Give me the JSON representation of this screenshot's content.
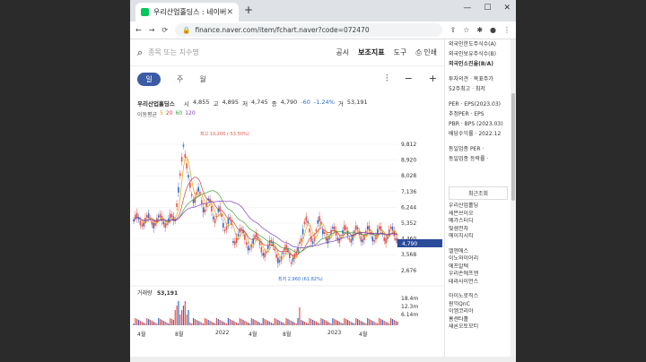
{
  "browser": {
    "tab_title": "우리산업홀딩스 : 네이버 증권",
    "url": "finance.naver.com/item/fchart.naver?code=072470"
  },
  "search": {
    "placeholder": "종목 또는 지수명",
    "links": [
      "공시",
      "보조지표",
      "도구",
      "인쇄"
    ]
  },
  "periods": [
    "일",
    "주",
    "월"
  ],
  "quote": {
    "name": "우리산업홀딩스",
    "open_label": "시",
    "open": "4,855",
    "high_label": "고",
    "high": "4,895",
    "low_label": "저",
    "low": "4,745",
    "close_label": "종",
    "close": "4,790",
    "change": "-60",
    "pct": "-1.24%",
    "vol_label": "거",
    "vol": "53,191"
  },
  "ma": {
    "label": "이동평균",
    "values": [
      "5",
      "20",
      "60",
      "120"
    ]
  },
  "chart_data": {
    "type": "line",
    "scale_label": "Linear",
    "y_ticks": [
      "9,812",
      "8,920",
      "8,028",
      "7,136",
      "6,244",
      "5,352",
      "4,460",
      "3,568",
      "2,676"
    ],
    "current_price": "4,790",
    "max_label": "최고 10,200 (-53.50%)",
    "min_label": "최저 2,960 (61.82%)",
    "volume_label": "거래량",
    "volume_value": "53,191",
    "volume_ticks": [
      "18.4m",
      "12.3m",
      "6.14m"
    ],
    "x_ticks": [
      "4월",
      "8월",
      "2022",
      "4월",
      "8월",
      "2023",
      "4월"
    ]
  },
  "side": {
    "top_lines": [
      "외국인한도주식수(A)",
      "외국인보유주식수(B)",
      "외국인소진율(B/A)"
    ],
    "invest_lines": [
      "투자의견 · 목표주가",
      "52주최고 · 최저"
    ],
    "per_lines": [
      "PER · EPS(2023.03)",
      "추정PER · EPS",
      "PBR · BPS (2023.03)",
      "배당수익률 · 2022.12"
    ],
    "peer_lines": [
      "동일업종 PER ·",
      "동일업종 등락률 ·"
    ],
    "recent_header": "최근조회",
    "recent_items": [
      "우리산업홀딩",
      "세븐브이오",
      "메가스터디",
      "빛샘전자",
      "에이치시티",
      "엘앤에스",
      "이노와이어리",
      "에프알텍",
      "우리손에프앤",
      "테라사이언스",
      "아이노로직스",
      "원익QnC",
      "이엠코리아",
      "홈센타홀",
      "새론오토모티"
    ]
  }
}
